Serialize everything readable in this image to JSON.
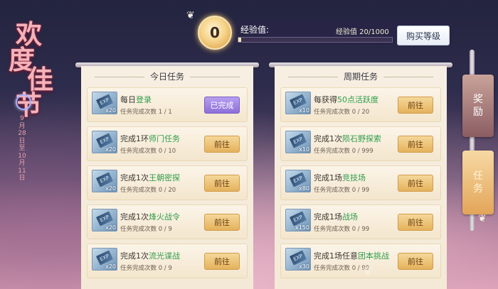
{
  "festival": {
    "title_chars": [
      "欢",
      "度",
      "佳",
      "节"
    ],
    "date": "9月28日至10月11日"
  },
  "exp": {
    "level": "0",
    "label": "经验值:",
    "value_text": "经验值 20/1000",
    "progress_fraction": 0.02,
    "buy_label": "购买等级"
  },
  "daily": {
    "title": "今日任务",
    "tasks": [
      {
        "prefix": "每日",
        "highlight": "登录",
        "suffix": "",
        "progress": "任务完成次数 1 / 1",
        "reward": "x20",
        "button": "已完成",
        "done": true
      },
      {
        "prefix": "完成1环",
        "highlight": "师门任务",
        "suffix": "",
        "progress": "任务完成次数 0 / 10",
        "reward": "x20",
        "button": "前往",
        "done": false
      },
      {
        "prefix": "完成1次",
        "highlight": "王朝密探",
        "suffix": "",
        "progress": "任务完成次数 0 / 20",
        "reward": "x20",
        "button": "前往",
        "done": false
      },
      {
        "prefix": "完成1次",
        "highlight": "烽火战令",
        "suffix": "",
        "progress": "任务完成次数 0 / 9",
        "reward": "x20",
        "button": "前往",
        "done": false
      },
      {
        "prefix": "完成1次",
        "highlight": "流光谍战",
        "suffix": "",
        "progress": "任务完成次数 0 / 9",
        "reward": "x20",
        "button": "前往",
        "done": false
      }
    ]
  },
  "weekly": {
    "title": "周期任务",
    "tasks": [
      {
        "prefix": "每获得",
        "highlight": "50点活跃度",
        "suffix": "",
        "progress": "任务完成次数 0 / 20",
        "reward": "x10",
        "button": "前往",
        "done": false
      },
      {
        "prefix": "完成1次",
        "highlight": "陨石野探索",
        "suffix": "",
        "progress": "任务完成次数 0 / 999",
        "reward": "x10",
        "button": "前往",
        "done": false
      },
      {
        "prefix": "完成1场",
        "highlight": "竞技场",
        "suffix": "",
        "progress": "任务完成次数 0 / 99",
        "reward": "x80",
        "button": "前往",
        "done": false
      },
      {
        "prefix": "完成1场",
        "highlight": "战场",
        "suffix": "",
        "progress": "任务完成次数 0 / 99",
        "reward": "x150",
        "button": "前往",
        "done": false
      },
      {
        "prefix": "完成1场任意",
        "highlight": "团本挑战",
        "suffix": "",
        "progress": "任务完成次数 0 / 99",
        "reward": "x30",
        "button": "前往",
        "done": false
      }
    ]
  },
  "ticket_label": "EXP",
  "side_tabs": {
    "reward": "奖励",
    "task": "任务"
  },
  "colors": {
    "highlight": "#2f9d4c",
    "go_button": "#e5b25c",
    "done_button": "#8e6fd9"
  }
}
